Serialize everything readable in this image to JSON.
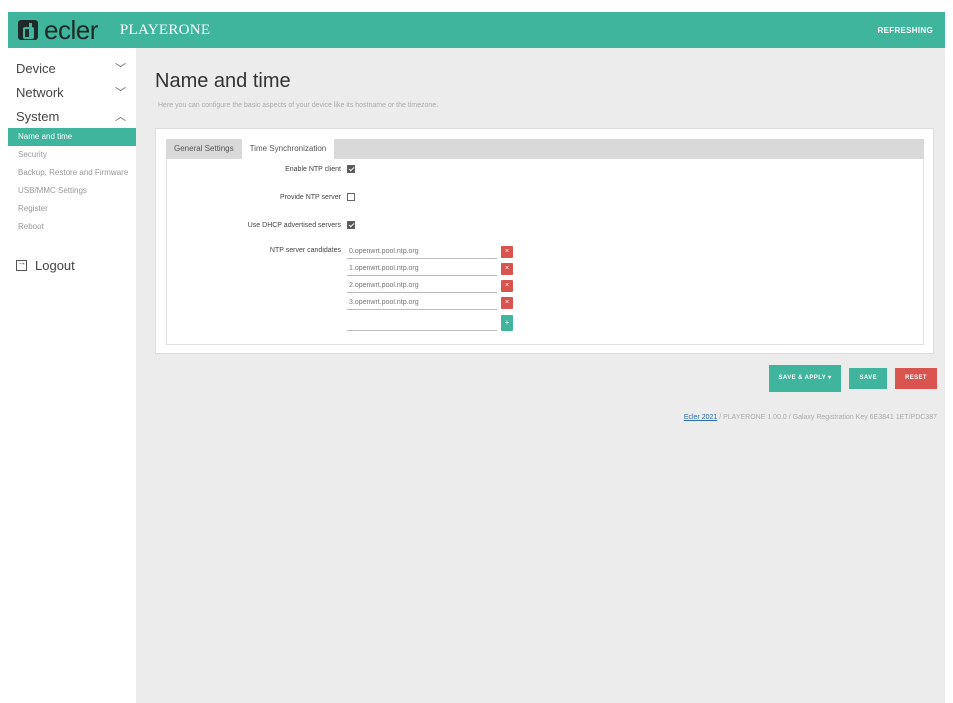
{
  "header": {
    "logo_text": "ecler",
    "product": "PLAYERONE",
    "refresh_label": "REFRESHING"
  },
  "sidebar": {
    "groups": [
      {
        "label": "Device",
        "chevron": "chevron-down"
      },
      {
        "label": "Network",
        "chevron": "chevron-down"
      },
      {
        "label": "System",
        "chevron": "chevron-up"
      }
    ],
    "system_items": [
      {
        "label": "Name and time",
        "active": true
      },
      {
        "label": "Security",
        "active": false
      },
      {
        "label": "Backup, Restore and Firmware",
        "active": false
      },
      {
        "label": "USB/MMC Settings",
        "active": false
      },
      {
        "label": "Register",
        "active": false
      },
      {
        "label": "Reboot",
        "active": false
      }
    ],
    "logout_label": "Logout"
  },
  "main": {
    "title": "Name and time",
    "description": "Here you can configure the basic aspects of your device like its hostname or the timezone.",
    "tabs": [
      {
        "label": "General Settings",
        "active": false
      },
      {
        "label": "Time Synchronization",
        "active": true
      }
    ],
    "form": {
      "enable_ntp_label": "Enable NTP client",
      "enable_ntp_checked": true,
      "provide_ntp_label": "Provide NTP server",
      "provide_ntp_checked": false,
      "dhcp_label": "Use DHCP advertised servers",
      "dhcp_checked": true,
      "candidates_label": "NTP server candidates",
      "servers": [
        "0.openwrt.pool.ntp.org",
        "1.openwrt.pool.ntp.org",
        "2.openwrt.pool.ntp.org",
        "3.openwrt.pool.ntp.org"
      ],
      "new_server_value": "",
      "delete_glyph": "×",
      "add_glyph": "+"
    }
  },
  "actions": {
    "save_apply": "SAVE & APPLY ▾",
    "save": "SAVE",
    "reset": "RESET"
  },
  "footer": {
    "link_text": "Ecler 2021",
    "rest": " / PLAYERONE 1.00.0 / Galaxy Registration Key 6E3841 1ET/PDC387"
  },
  "colors": {
    "accent": "#3eb59c",
    "danger": "#d9534f"
  }
}
